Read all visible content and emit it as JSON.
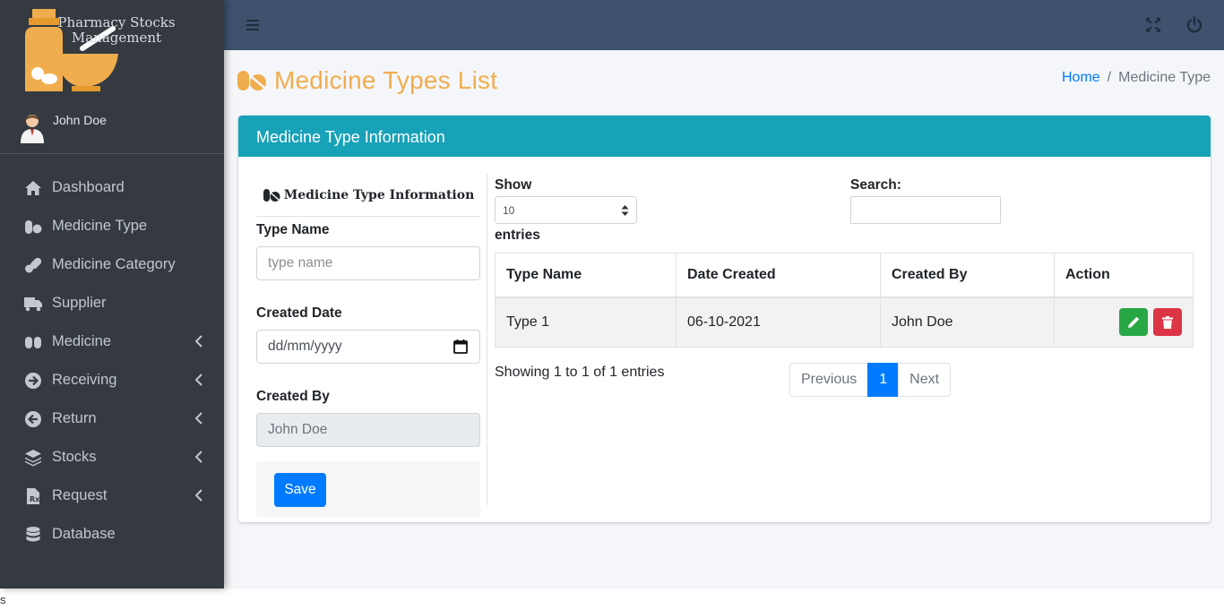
{
  "brand": {
    "line1": "Pharmacy Stocks",
    "line2": "Management"
  },
  "user": {
    "name": "John Doe"
  },
  "sidebar": {
    "items": [
      {
        "label": "Dashboard",
        "icon": "home-icon",
        "has_submenu": false
      },
      {
        "label": "Medicine Type",
        "icon": "pills-icon",
        "has_submenu": false
      },
      {
        "label": "Medicine Category",
        "icon": "capsules-icon",
        "has_submenu": false
      },
      {
        "label": "Supplier",
        "icon": "truck-icon",
        "has_submenu": false
      },
      {
        "label": "Medicine",
        "icon": "medkit-icon",
        "has_submenu": true
      },
      {
        "label": "Receiving",
        "icon": "arrow-circle-right-icon",
        "has_submenu": true
      },
      {
        "label": "Return",
        "icon": "arrow-circle-left-icon",
        "has_submenu": true
      },
      {
        "label": "Stocks",
        "icon": "layers-icon",
        "has_submenu": true
      },
      {
        "label": "Request",
        "icon": "prescription-file-icon",
        "has_submenu": true
      },
      {
        "label": "Database",
        "icon": "database-icon",
        "has_submenu": false
      }
    ]
  },
  "page": {
    "title": "Medicine Types List",
    "breadcrumb": {
      "home": "Home",
      "separator": "/",
      "current": "Medicine Type"
    }
  },
  "card": {
    "header": "Medicine Type Information"
  },
  "form": {
    "heading": "Medicine Type Information",
    "type_name_label": "Type Name",
    "type_name_placeholder": "type name",
    "created_date_label": "Created Date",
    "created_date_placeholder": "dd/mm/yyyy",
    "created_by_label": "Created By",
    "created_by_value": "John Doe",
    "save_label": "Save"
  },
  "datatable": {
    "show_label": "Show",
    "page_length": "10",
    "entries_label": "entries",
    "search_label": "Search:",
    "columns": [
      "Type Name",
      "Date Created",
      "Created By",
      "Action"
    ],
    "rows": [
      {
        "type_name": "Type 1",
        "date_created": "06-10-2021",
        "created_by": "John Doe"
      }
    ],
    "info": "Showing 1 to 1 of 1 entries",
    "pagination": {
      "previous": "Previous",
      "current": "1",
      "next": "Next"
    }
  },
  "footer_stray": "s",
  "colors": {
    "sidebar": "#343a40",
    "topbar": "#3e526d",
    "accent_orange": "#f0ad4e",
    "card_header": "#17a2b8",
    "primary": "#007bff",
    "success": "#28a745",
    "danger": "#dc3545"
  }
}
